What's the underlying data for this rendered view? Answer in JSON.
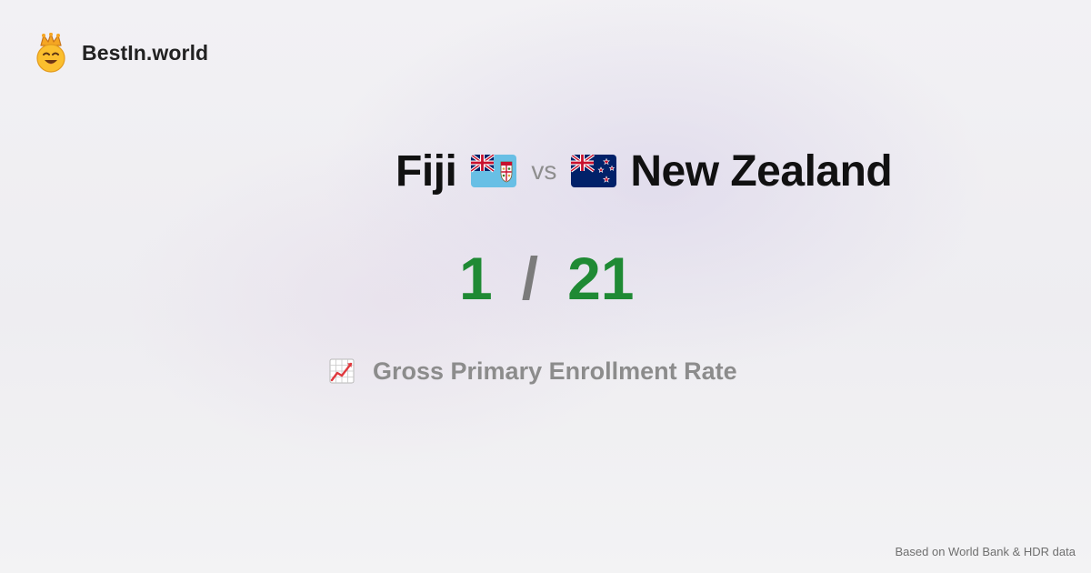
{
  "brand": {
    "name": "BestIn.world",
    "logo_icon": "crowned-smiley-icon"
  },
  "comparison": {
    "country_a": {
      "name": "Fiji",
      "flag_icon": "fiji-flag-icon"
    },
    "separator": "vs",
    "country_b": {
      "name": "New Zealand",
      "flag_icon": "new-zealand-flag-icon"
    }
  },
  "ranks": {
    "rank_a": "1",
    "separator": "/",
    "rank_b": "21"
  },
  "metric": {
    "icon": "chart-increasing-icon",
    "label": "Gross Primary Enrollment Rate"
  },
  "footer": {
    "source": "Based on World Bank & HDR data"
  },
  "colors": {
    "rank_green": "#1f8a34",
    "muted_gray": "#8c8c8c",
    "background": "#f1f0f3"
  }
}
